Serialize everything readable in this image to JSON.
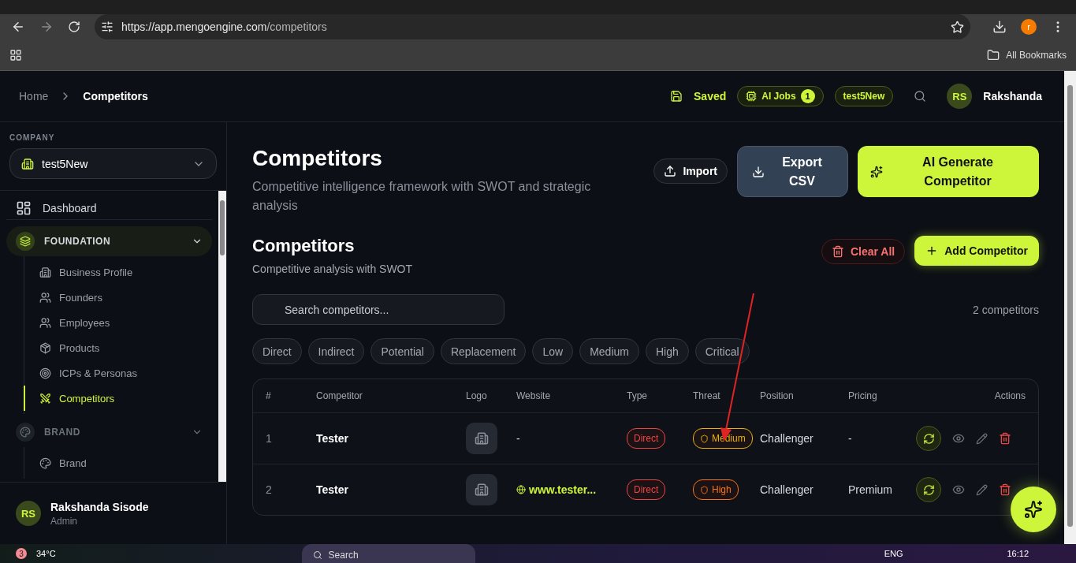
{
  "browser": {
    "url_host": "https://app.mengoengine.com",
    "url_path": "/competitors",
    "profile_initial": "r",
    "bookmarks_label": "All Bookmarks"
  },
  "header": {
    "breadcrumbs": [
      {
        "label": "Home",
        "selected": false
      },
      {
        "label": "Competitors",
        "selected": true
      }
    ],
    "saved": "Saved",
    "ai_jobs": {
      "label": "AI Jobs",
      "count": "1"
    },
    "workspace": "test5New",
    "user": {
      "initials": "RS",
      "name": "Rakshanda"
    }
  },
  "sidebar": {
    "company_label": "COMPANY",
    "company": "test5New",
    "items": [
      {
        "kind": "link",
        "label": "Dashboard"
      },
      {
        "kind": "section",
        "label": "FOUNDATION",
        "selected": true,
        "expanded": true,
        "children": [
          {
            "label": "Business Profile",
            "selected": false
          },
          {
            "label": "Founders",
            "selected": false
          },
          {
            "label": "Employees",
            "selected": false
          },
          {
            "label": "Products",
            "selected": false
          },
          {
            "label": "ICPs & Personas",
            "selected": false
          },
          {
            "label": "Competitors",
            "selected": true
          }
        ]
      },
      {
        "kind": "section",
        "label": "BRAND",
        "selected": false,
        "expanded": true,
        "children": [
          {
            "label": "Brand",
            "selected": false
          }
        ]
      }
    ],
    "user": {
      "initials": "RS",
      "name": "Rakshanda Sisode",
      "role": "Admin"
    }
  },
  "page": {
    "title": "Competitors",
    "subtitle": "Competitive intelligence framework with SWOT and strategic analysis",
    "actions": [
      {
        "kind": "outline",
        "label": "Import"
      },
      {
        "kind": "slate",
        "label": "Export CSV"
      },
      {
        "kind": "primary",
        "label": "AI Generate Competitor"
      }
    ]
  },
  "section": {
    "title": "Competitors",
    "subtitle": "Competitive analysis with SWOT",
    "actions": [
      {
        "kind": "danger",
        "label": "Clear All"
      },
      {
        "kind": "primary",
        "label": "Add Competitor"
      }
    ],
    "search": {
      "placeholder": "Search competitors..."
    },
    "count": "2 competitors",
    "filters": [
      {
        "label": "Direct",
        "selected": false
      },
      {
        "label": "Indirect",
        "selected": false
      },
      {
        "label": "Potential",
        "selected": false
      },
      {
        "label": "Replacement",
        "selected": false
      },
      {
        "label": "Low",
        "selected": false
      },
      {
        "label": "Medium",
        "selected": false
      },
      {
        "label": "High",
        "selected": false
      },
      {
        "label": "Critical",
        "selected": false
      }
    ]
  },
  "table": {
    "columns": [
      "#",
      "Competitor",
      "Logo",
      "Website",
      "Type",
      "Threat",
      "Position",
      "Pricing",
      "Actions"
    ],
    "rows": [
      {
        "number": "1",
        "competitor": "Tester",
        "website": {
          "kind": "none",
          "text": "-"
        },
        "type": {
          "label": "Direct",
          "color": "#ef4444"
        },
        "threat": {
          "label": "Medium",
          "color": "#eab308"
        },
        "position": "Challenger",
        "pricing": "-"
      },
      {
        "number": "2",
        "competitor": "Tester",
        "website": {
          "kind": "link",
          "text": "www.tester..."
        },
        "type": {
          "label": "Direct",
          "color": "#ef4444"
        },
        "threat": {
          "label": "High",
          "color": "#f97316"
        },
        "position": "Challenger",
        "pricing": "Premium"
      }
    ]
  },
  "taskbar": {
    "weather": "34°C",
    "weather_badge": "3",
    "search": "Search",
    "language": "ENG",
    "time": "16:12"
  }
}
